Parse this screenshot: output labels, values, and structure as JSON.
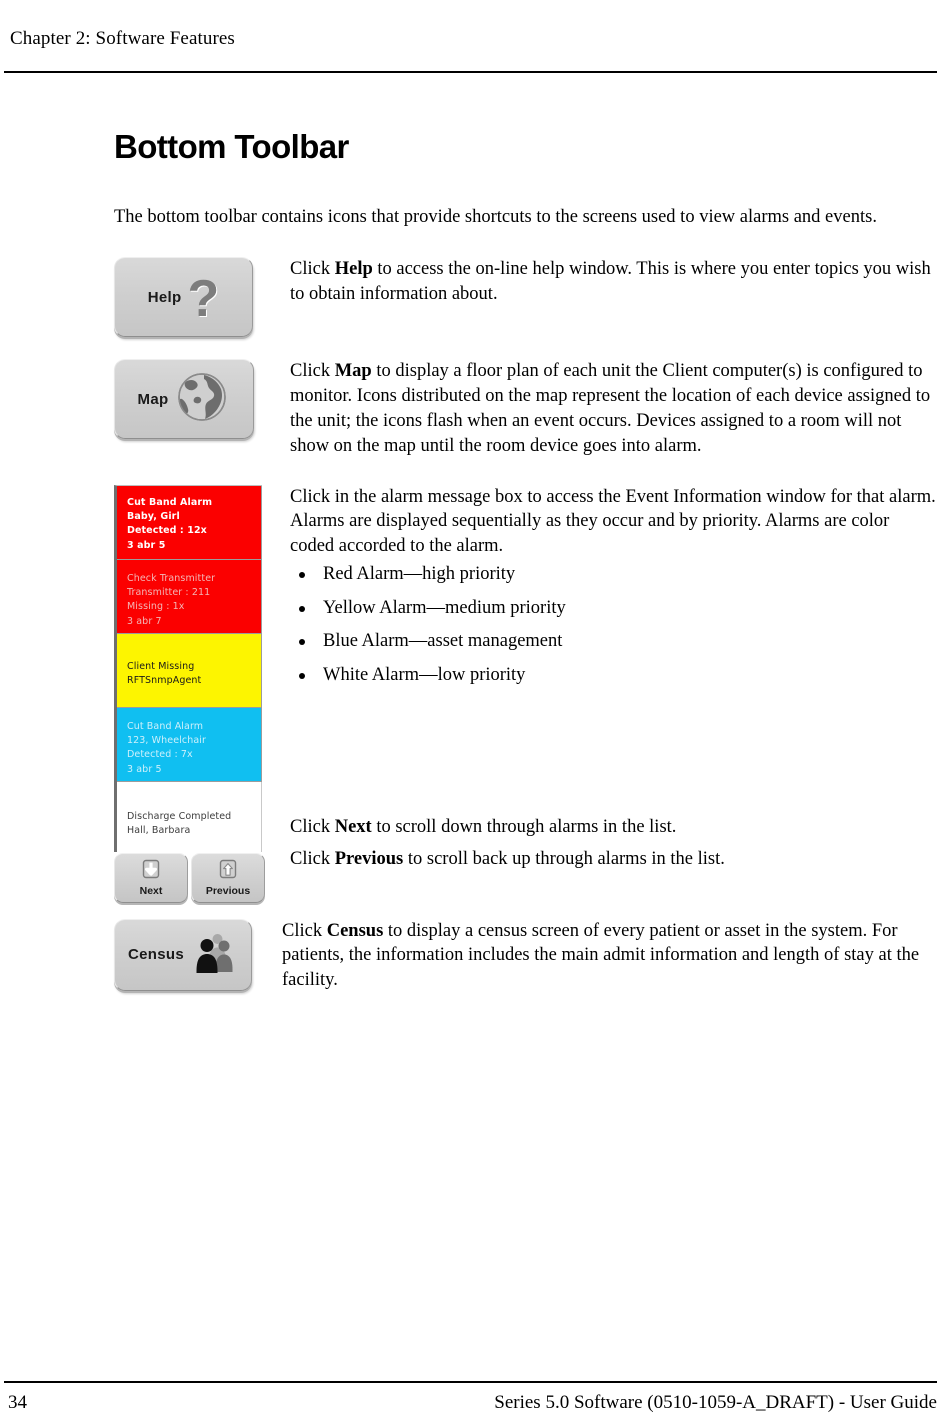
{
  "header": {
    "chapter": "Chapter 2: Software Features"
  },
  "main": {
    "title": "Bottom Toolbar",
    "intro": "The bottom toolbar contains icons that provide shortcuts to the screens used to view alarms and events."
  },
  "buttons": {
    "help": {
      "label": "Help",
      "icon": "question-mark-icon"
    },
    "map": {
      "label": "Map",
      "icon": "globe-icon"
    },
    "census": {
      "label": "Census",
      "icon": "people-icon"
    },
    "next": {
      "label": "Next",
      "icon": "arrow-down-icon"
    },
    "previous": {
      "label": "Previous",
      "icon": "arrow-up-icon"
    }
  },
  "descriptions": {
    "help": {
      "prefix": "Click ",
      "bold": "Help",
      "rest": " to access the on-line help window. This is where you enter topics you wish to obtain information about."
    },
    "map": {
      "prefix": "Click ",
      "bold": "Map",
      "rest": " to display a floor plan of each unit the Client computer(s) is configured to monitor. Icons distributed on the map represent the location of each device assigned to the unit; the icons flash when an event occurs. Devices assigned to a room will not show on the map until the room device goes into alarm."
    },
    "alarm_box": "Click in the alarm message box to access the Event Information window for that alarm. Alarms are displayed sequentially as they occur and by priority. Alarms are color coded accorded to the alarm.",
    "next": {
      "prefix": "Click ",
      "bold": "Next",
      "rest": " to scroll down through alarms in the list."
    },
    "previous": {
      "prefix": "Click ",
      "bold": "Previous",
      "rest": " to scroll back up through alarms in the list."
    },
    "census": {
      "prefix": "Click ",
      "bold": "Census",
      "rest": " to display a census screen of every patient or asset in the system. For patients, the information includes the main admit information and length of stay at the facility."
    }
  },
  "alarm_color_legend": [
    "Red Alarm—high priority",
    "Yellow Alarm—medium priority",
    "Blue Alarm—asset management",
    "White Alarm—low priority"
  ],
  "alarm_list": [
    {
      "priority": "red",
      "color": "#fb0000",
      "text_style": "white-bold",
      "lines": [
        "Cut Band Alarm",
        "Baby, Girl",
        "Detected : 12x",
        "3 abr 5"
      ]
    },
    {
      "priority": "red",
      "color": "#fb0000",
      "text_style": "white-soft",
      "lines": [
        "Check Transmitter",
        "Transmitter : 211",
        "Missing : 1x",
        "3 abr 7"
      ]
    },
    {
      "priority": "yellow",
      "color": "#fdf500",
      "text_style": "black",
      "lines": [
        "Client Missing",
        "RFTSnmpAgent"
      ]
    },
    {
      "priority": "blue",
      "color": "#10bff1",
      "text_style": "blue-soft",
      "lines": [
        "Cut Band Alarm",
        "123, Wheelchair",
        "Detected : 7x",
        "3 abr 5"
      ]
    },
    {
      "priority": "white",
      "color": "#ffffff",
      "text_style": "gray",
      "lines": [
        "Discharge Completed",
        "Hall, Barbara"
      ]
    }
  ],
  "footer": {
    "page_number": "34",
    "doc_reference": "Series 5.0 Software (0510-1059-A_DRAFT) - User Guide"
  }
}
